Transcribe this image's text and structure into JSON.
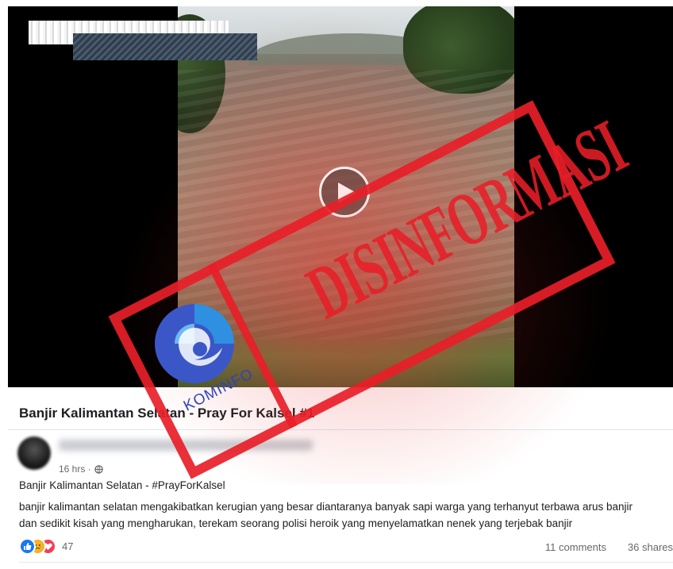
{
  "post": {
    "title": "Banjir Kalimantan Selatan - Pray For Kalsel #1",
    "timestamp": "16 hrs ·",
    "heading": "Banjir Kalimantan Selatan - #PrayForKalsel",
    "body_lines": [
      "banjir kalimantan selatan mengakibatkan kerugian yang besar diantaranya banyak sapi warga yang terhanyut terbawa arus banjir",
      "dan sedikit kisah yang mengharukan, terekam seorang polisi heroik yang menyelamatkan nenek yang terjebak banjir"
    ],
    "reaction_icons": [
      "like-icon",
      "sad-icon",
      "love-icon"
    ],
    "reaction_count": "47",
    "comments": "11 comments",
    "shares": "36 shares"
  },
  "overlay": {
    "stamp_text": "DISINFORMASI",
    "stamp_color": "#e81e28",
    "logo_text": "KOMINFO",
    "logo_color": "#2e44b8"
  },
  "video": {
    "play_icon": "play-icon"
  }
}
